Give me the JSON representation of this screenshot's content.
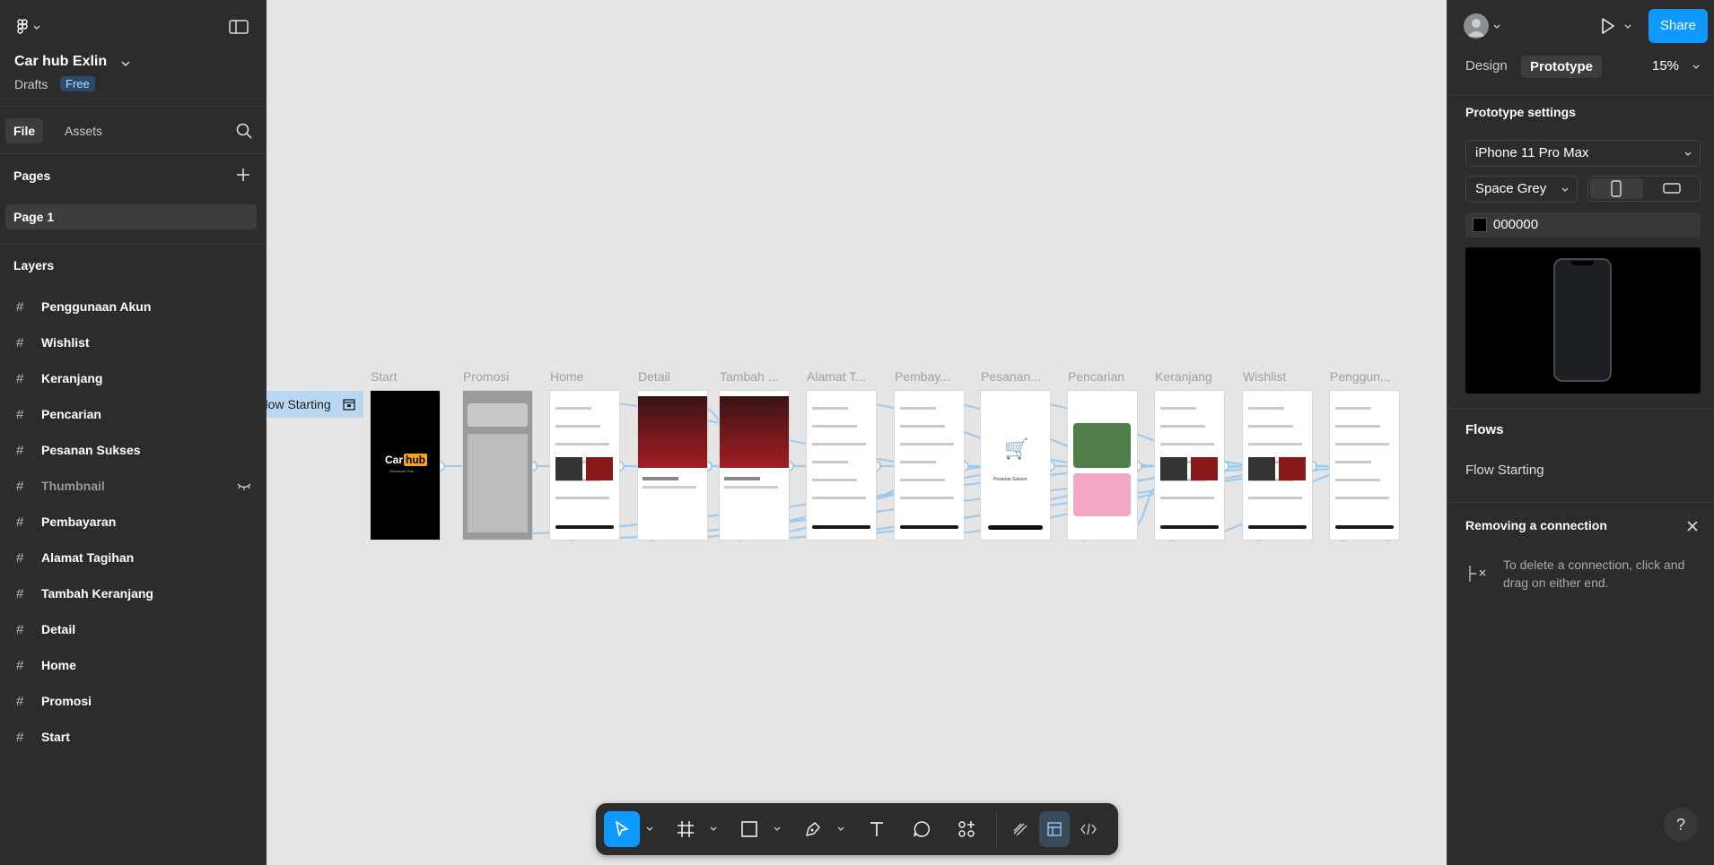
{
  "left_panel": {
    "file_name": "Car hub Exlin",
    "location": "Drafts",
    "plan_badge": "Free",
    "tabs": {
      "file": "File",
      "assets": "Assets"
    },
    "pages_heading": "Pages",
    "pages": [
      "Page 1"
    ],
    "layers_heading": "Layers",
    "layers": [
      {
        "name": "Penggunaan Akun",
        "hidden": false
      },
      {
        "name": "Wishlist",
        "hidden": false
      },
      {
        "name": "Keranjang",
        "hidden": false
      },
      {
        "name": "Pencarian",
        "hidden": false
      },
      {
        "name": "Pesanan Sukses",
        "hidden": false
      },
      {
        "name": "Thumbnail",
        "hidden": true
      },
      {
        "name": "Pembayaran",
        "hidden": false
      },
      {
        "name": "Alamat Tagihan",
        "hidden": false
      },
      {
        "name": "Tambah Keranjang",
        "hidden": false
      },
      {
        "name": "Detail",
        "hidden": false
      },
      {
        "name": "Home",
        "hidden": false
      },
      {
        "name": "Promosi",
        "hidden": false
      },
      {
        "name": "Start",
        "hidden": false
      }
    ]
  },
  "canvas": {
    "flow_tag": "Flow Starting",
    "frames": [
      "Start",
      "Promosi",
      "Home",
      "Detail",
      "Tambah ...",
      "Alamat T...",
      "Pembay...",
      "Pesanan...",
      "Pencarian",
      "Keranjang",
      "Wishlist",
      "Penggun..."
    ],
    "start_logo": {
      "car": "Car",
      "hub": "hub",
      "tag": "Wholesale Part"
    },
    "success_text": "Pesanan Sukses",
    "connection_color": "#9ecbf0"
  },
  "toolbar": {
    "tools": [
      "move-tool",
      "frame-tool",
      "shape-tool",
      "pen-tool",
      "text-tool",
      "comment-tool",
      "actions-tool"
    ],
    "modes": [
      "draw-mode",
      "design-mode",
      "dev-mode"
    ],
    "active_tool": "move-tool",
    "selected_mode": "design-mode"
  },
  "right_panel": {
    "share": "Share",
    "tabs": {
      "design": "Design",
      "prototype": "Prototype"
    },
    "zoom": "15%",
    "prototype_settings": "Prototype settings",
    "device": "iPhone 11 Pro Max",
    "device_color": "Space Grey",
    "background_hex": "000000",
    "flows_heading": "Flows",
    "flows": [
      "Flow Starting"
    ],
    "hint_title": "Removing a connection",
    "hint_text": "To delete a connection, click and drag on either end.",
    "help": "?"
  },
  "colors": {
    "accent": "#0d99ff",
    "panel": "#2c2c2c",
    "canvas": "#e5e5e5"
  }
}
